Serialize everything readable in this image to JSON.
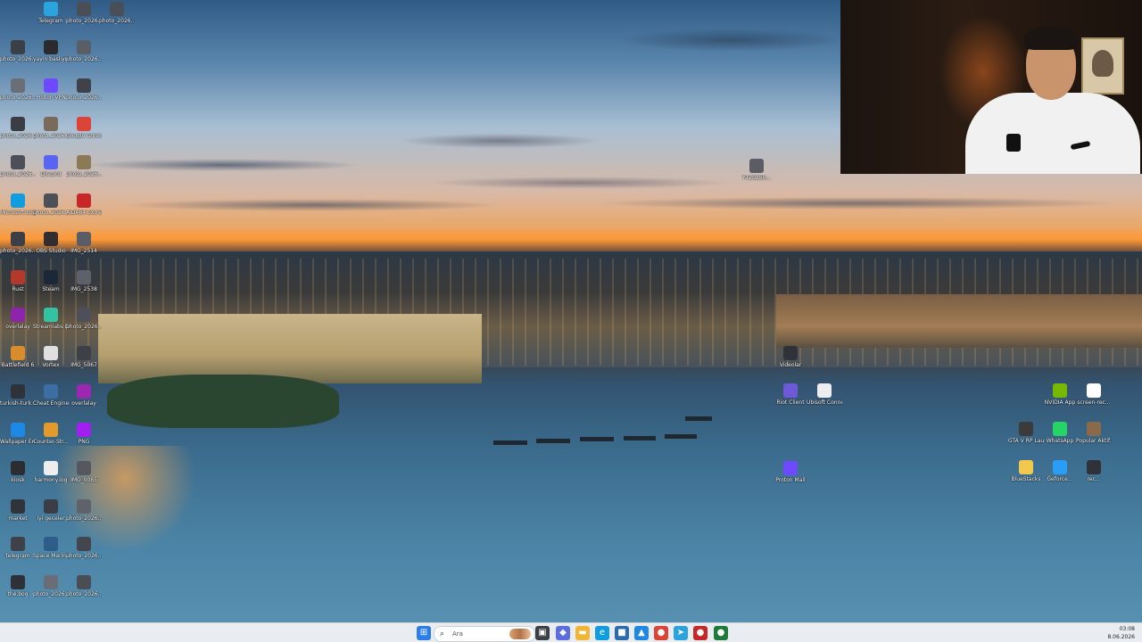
{
  "desktop": {
    "icons_left": [
      {
        "label": "Telegram",
        "icon": "telegram-icon",
        "color": "#2aa3de"
      },
      {
        "label": "photo_2026...",
        "icon": "photo-icon",
        "color": "#4a4f57"
      },
      {
        "label": "photo_2026...",
        "icon": "photo-icon",
        "color": "#4a4f57"
      },
      {
        "label": "photo_2026...",
        "icon": "photo-icon",
        "color": "#3b3f46"
      },
      {
        "label": "yayin basliyor",
        "icon": "image-icon",
        "color": "#2b2b2b"
      },
      {
        "label": "photo_2026...",
        "icon": "photo-icon",
        "color": "#5a5e66"
      },
      {
        "label": "photo_2026...",
        "icon": "photo-icon",
        "color": "#6a6e76"
      },
      {
        "label": "Proton VPN",
        "icon": "proton-vpn-icon",
        "color": "#6d4aff"
      },
      {
        "label": "photo_2026...",
        "icon": "photo-icon",
        "color": "#3f4249"
      },
      {
        "label": "photo_2026...",
        "icon": "photo-icon",
        "color": "#3a3d44"
      },
      {
        "label": "photo_2026...",
        "icon": "photo-icon",
        "color": "#7a6a5a"
      },
      {
        "label": "Google Chrome",
        "icon": "chrome-icon",
        "color": "#db4437"
      },
      {
        "label": "photo_2026...",
        "icon": "photo-icon",
        "color": "#4b4f57"
      },
      {
        "label": "Discord",
        "icon": "discord-icon",
        "color": "#5865f2"
      },
      {
        "label": "photo_2026...",
        "icon": "photo-icon",
        "color": "#8a7a55"
      },
      {
        "label": "Microsoft Edge",
        "icon": "edge-icon",
        "color": "#0f9ddf"
      },
      {
        "label": "photo_2026...",
        "icon": "photo-icon",
        "color": "#4c5058"
      },
      {
        "label": "AIDA64 Extreme",
        "icon": "aida64-icon",
        "color": "#c62828"
      },
      {
        "label": "photo_2026...",
        "icon": "photo-icon",
        "color": "#3c3f46"
      },
      {
        "label": "OBS Studio",
        "icon": "obs-icon",
        "color": "#302e31"
      },
      {
        "label": "IMG_2514",
        "icon": "photo-icon",
        "color": "#5a5d65"
      },
      {
        "label": "Rust",
        "icon": "rust-icon",
        "color": "#b33a2a"
      },
      {
        "label": "Steam",
        "icon": "steam-icon",
        "color": "#1b2838"
      },
      {
        "label": "IMG_2538",
        "icon": "photo-icon",
        "color": "#5e6169"
      },
      {
        "label": "overlalay",
        "icon": "image-icon",
        "color": "#8e24aa"
      },
      {
        "label": "Streamlabs Desktop",
        "icon": "streamlabs-icon",
        "color": "#31c3a2"
      },
      {
        "label": "photo_2026...",
        "icon": "photo-icon",
        "color": "#4d5058"
      },
      {
        "label": "Battlefield 6",
        "icon": "battlefield-icon",
        "color": "#d98c2b"
      },
      {
        "label": "Vortex",
        "icon": "vortex-icon",
        "color": "#e0e0e0"
      },
      {
        "label": "IMG_5067",
        "icon": "photo-icon",
        "color": "#3d4047"
      },
      {
        "label": "turkish-turk...",
        "icon": "photo-icon",
        "color": "#2f3238"
      },
      {
        "label": "Cheat Engine",
        "icon": "cheat-engine-icon",
        "color": "#3a6ea5"
      },
      {
        "label": "overlalay",
        "icon": "image-icon",
        "color": "#9c27b0"
      },
      {
        "label": "Wallpaper Engine",
        "icon": "wallpaper-engine-icon",
        "color": "#1e88e5"
      },
      {
        "label": "Counter-Str...",
        "icon": "counter-strike-icon",
        "color": "#e39a2d"
      },
      {
        "label": "PNG",
        "icon": "image-icon",
        "color": "#a020f0"
      },
      {
        "label": "kiosk",
        "icon": "photo-icon",
        "color": "#2b2d31"
      },
      {
        "label": "harmony.log",
        "icon": "file-icon",
        "color": "#eeeeee"
      },
      {
        "label": "IMG_0085",
        "icon": "photo-icon",
        "color": "#55585f"
      },
      {
        "label": "market",
        "icon": "photo-icon",
        "color": "#30333a"
      },
      {
        "label": "iyi geceler",
        "icon": "image-icon",
        "color": "#3a3d44"
      },
      {
        "label": "photo_2026...",
        "icon": "photo-icon",
        "color": "#5f626a"
      },
      {
        "label": "telegram",
        "icon": "photo-icon",
        "color": "#3e4148"
      },
      {
        "label": "Space Marine 2 (TL)",
        "icon": "space-marine-icon",
        "color": "#2f5d8a"
      },
      {
        "label": "photo_2026...",
        "icon": "photo-icon",
        "color": "#43464d"
      },
      {
        "label": "the.bog",
        "icon": "photo-icon",
        "color": "#2e3137"
      },
      {
        "label": "photo_2026...",
        "icon": "photo-icon",
        "color": "#6a6d75"
      },
      {
        "label": "photo_2026...",
        "icon": "photo-icon",
        "color": "#4a4d54"
      },
      {
        "label": "mota",
        "icon": "photo-icon",
        "color": "#34373d"
      },
      {
        "label": "photo_2026...",
        "icon": "photo-icon",
        "color": "#575a61"
      },
      {
        "label": "photo_2026...",
        "icon": "photo-icon",
        "color": "#b03060"
      },
      {
        "label": "attila kick",
        "icon": "folder-icon",
        "color": "#f2c44b"
      }
    ],
    "icons_mid": [
      {
        "label": "YT20250...",
        "icon": "photo-icon",
        "color": "#5a5d65"
      },
      {
        "label": "Videolar",
        "icon": "photo-icon",
        "color": "#2f3238"
      },
      {
        "label": "Riot Client",
        "icon": "riot-icon",
        "color": "#6e59d6"
      },
      {
        "label": "Ubisoft Connect",
        "icon": "ubisoft-icon",
        "color": "#eeeeee"
      },
      {
        "label": "Proton Mail",
        "icon": "proton-mail-icon",
        "color": "#6d4aff"
      }
    ],
    "icons_right": [
      {
        "label": "NVIDIA App",
        "icon": "nvidia-icon",
        "color": "#76b900"
      },
      {
        "label": "screen-rec...",
        "icon": "record-icon",
        "color": "#ffffff"
      },
      {
        "label": "GTA V RP Launcher",
        "icon": "gta-icon",
        "color": "#3b3b3b"
      },
      {
        "label": "WhatsApp",
        "icon": "whatsapp-icon",
        "color": "#25d366"
      },
      {
        "label": "Popular Aktif...",
        "icon": "photo-icon",
        "color": "#8a6a4a"
      },
      {
        "label": "BlueStacks",
        "icon": "bluestacks-icon",
        "color": "#f2c94c"
      },
      {
        "label": "Geforce...",
        "icon": "geforce-icon",
        "color": "#2a9df4"
      },
      {
        "label": "rec...",
        "icon": "photo-icon",
        "color": "#2f3238"
      }
    ]
  },
  "taskbar": {
    "search_placeholder": "Ara",
    "apps": [
      {
        "name": "start-button",
        "icon": "windows-icon",
        "color": "#2b7de9",
        "glyph": "⊞"
      },
      {
        "name": "task-view",
        "icon": "task-view-icon",
        "color": "#3b3f46",
        "glyph": "▣"
      },
      {
        "name": "widgets",
        "icon": "widgets-icon",
        "color": "#5b6ee1",
        "glyph": "◆"
      },
      {
        "name": "file-explorer",
        "icon": "folder-icon",
        "color": "#f2b632",
        "glyph": "▬"
      },
      {
        "name": "edge",
        "icon": "edge-icon",
        "color": "#0f9ddf",
        "glyph": "e"
      },
      {
        "name": "store",
        "icon": "store-icon",
        "color": "#2b6cb0",
        "glyph": "■"
      },
      {
        "name": "photos",
        "icon": "photos-icon",
        "color": "#1e88e5",
        "glyph": "▲"
      },
      {
        "name": "chrome",
        "icon": "chrome-icon",
        "color": "#db4437",
        "glyph": "●"
      },
      {
        "name": "telegram",
        "icon": "telegram-icon",
        "color": "#2aa3de",
        "glyph": "➤"
      },
      {
        "name": "app-red",
        "icon": "app-icon",
        "color": "#c62828",
        "glyph": "●"
      },
      {
        "name": "obs",
        "icon": "obs-icon",
        "color": "#1f7a3a",
        "glyph": "●"
      }
    ],
    "time": "03:08",
    "date": "8.06.2026"
  }
}
